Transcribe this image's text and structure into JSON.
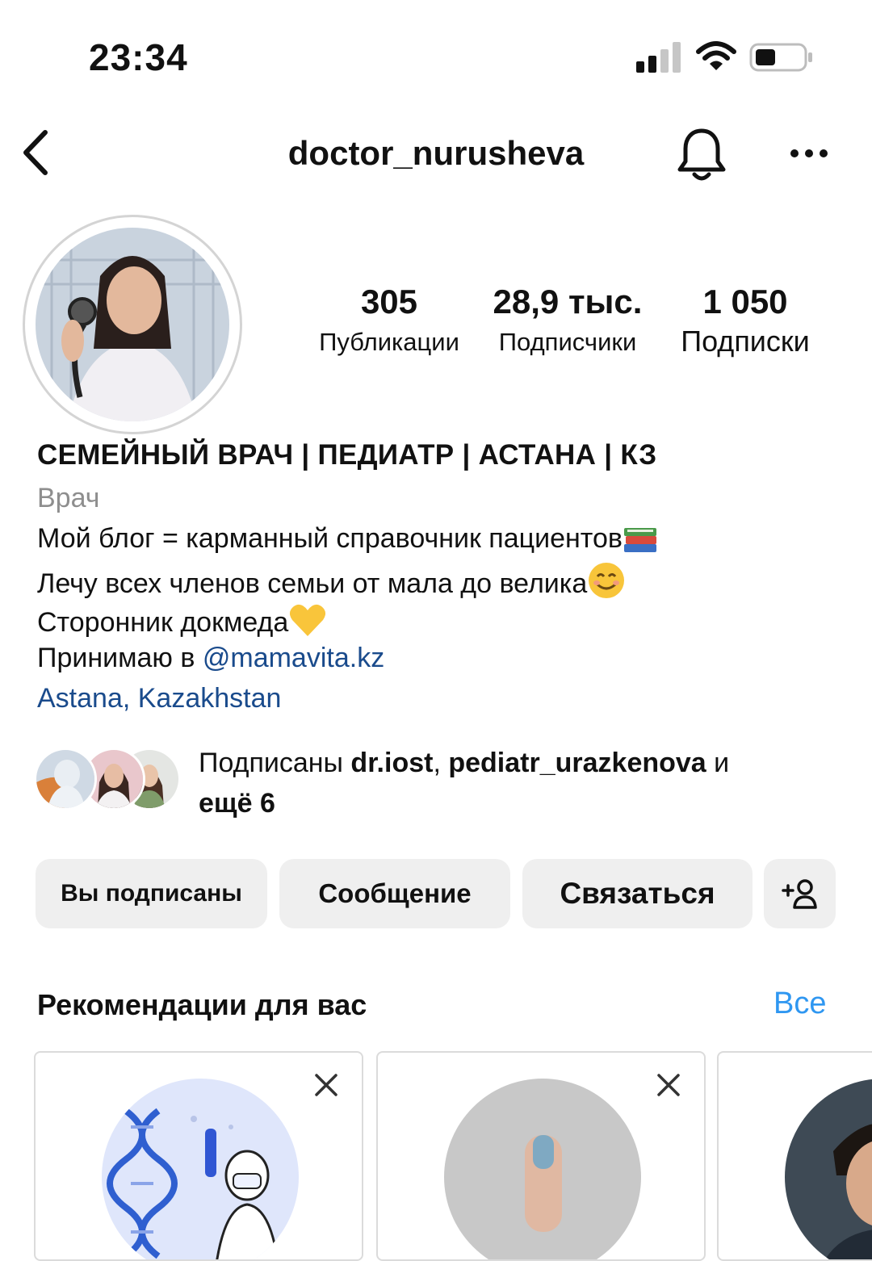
{
  "status_bar": {
    "time": "23:34"
  },
  "header": {
    "username": "doctor_nurusheva"
  },
  "stats": {
    "posts": {
      "value": "305",
      "label": "Публикации"
    },
    "followers": {
      "value": "28,9 тыс.",
      "label": "Подписчики"
    },
    "following": {
      "value": "1 050",
      "label": "Подписки"
    }
  },
  "bio": {
    "name": "СЕМЕЙНЫЙ ВРАЧ | ПЕДИАТР | АСТАНА | КЗ",
    "category": "Врач",
    "line1": "Мой блог = карманный справочник пациентов",
    "line2": "Лечу всех членов семьи от мала до велика",
    "line3": "Сторонник докмеда",
    "line4_prefix": "Принимаю в ",
    "line4_mention": "@mamavita.kz",
    "location": "Astana, Kazakhstan"
  },
  "mutual": {
    "prefix": "Подписаны ",
    "user1": "dr.iost",
    "sep": ", ",
    "user2": "pediatr_urazkenova",
    "conj": " и",
    "more": "ещё 6"
  },
  "buttons": {
    "following": "Вы подписаны",
    "message": "Сообщение",
    "contact": "Связаться"
  },
  "recommendations": {
    "title": "Рекомендации для вас",
    "see_all": "Все"
  },
  "icons": {
    "back": "chevron-left-icon",
    "notifications": "bell-icon",
    "more": "more-horizontal-icon",
    "add_person": "person-add-icon",
    "close": "close-icon"
  },
  "colors": {
    "link": "#1a4b8c",
    "accent": "#2f97f1",
    "button_bg": "#efefef",
    "secondary_text": "#8e8e8e"
  }
}
